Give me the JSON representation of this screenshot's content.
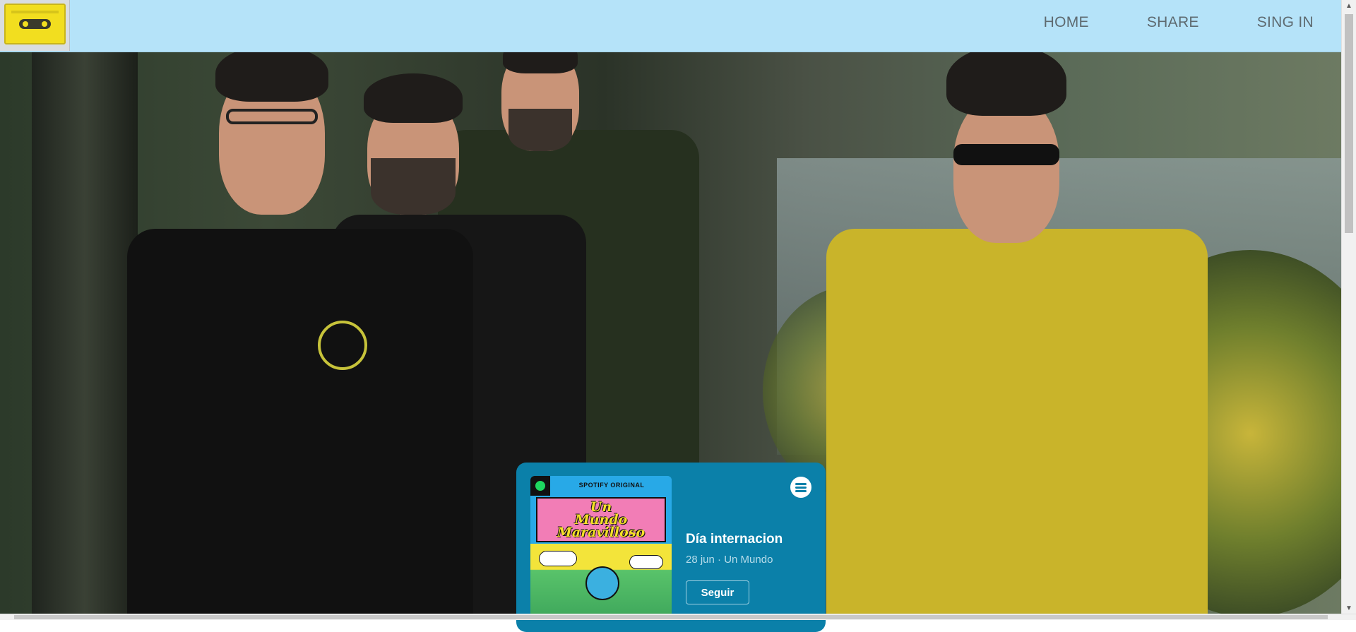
{
  "header": {
    "logo_alt": "cassette tape logo",
    "nav": [
      {
        "label": "HOME"
      },
      {
        "label": "SHARE"
      },
      {
        "label": "SING IN"
      }
    ]
  },
  "hero": {
    "description_icon": "band-photo"
  },
  "spotify_embed": {
    "cover_badge": "SPOTIFY ORIGINAL",
    "cover_title_line1": "Un",
    "cover_title_line2": "Mundo",
    "cover_title_line3": "Maravilloso",
    "episode_title": "Día internacion",
    "episode_meta": "28 jun · Un Mundo",
    "follow_label": "Seguir",
    "colors": {
      "background": "#0b80a9",
      "cover": "#28a9e7"
    }
  },
  "colors": {
    "header_bg": "#b5e3f9",
    "nav_text": "#5e6a70"
  }
}
